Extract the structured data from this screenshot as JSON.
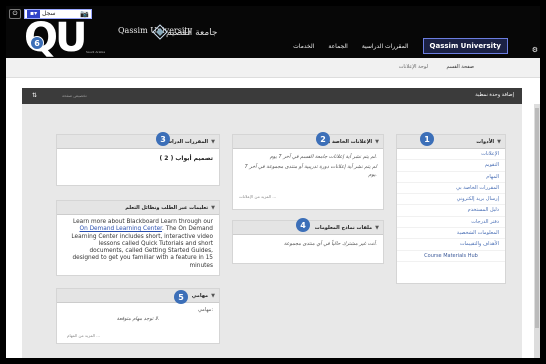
{
  "toolbar": {
    "power_icon": "power-icon",
    "recording_label": "سجل",
    "camera_icon": "camera-icon"
  },
  "header": {
    "logo": "QU",
    "logo_sub": "Saudi Arabia",
    "university_name_en": "Qassim University",
    "university_name_ar": "جامعة القصيم",
    "nav": [
      {
        "label": "الخدمات"
      },
      {
        "label": "الجماعة"
      },
      {
        "label": "المقررات الدراسية"
      }
    ],
    "active_tab": "Qassim University"
  },
  "subheader": {
    "tab_a": "صفحة القسم",
    "tab_b": "لوحة الإعلانات"
  },
  "page_bar": {
    "title": "إضافة وحدة نمطية",
    "left_icon": "⇅",
    "left_text": "تخصيص صفحة"
  },
  "modules": {
    "tools": {
      "title": "الأدوات",
      "items": [
        "الإعلانات",
        "التقويم",
        "المهام",
        "المقررات الخاصة بي",
        "إرسال بريد إلكتروني",
        "دليل المستخدم",
        "دفتر الدرجات",
        "المعلومات الشخصية",
        "الأهداف والتقييمات",
        "Course Materials Hub"
      ]
    },
    "my_announcements": {
      "title": "الإعلانات الخاصة بي",
      "lines": [
        "لم يتم نشر أية إعلانات جامعة القسم في آخر 7 يوم.",
        "لم يتم نشر أية إعلانات دورة تدريبية أو منتدى مجموعة في آخر 7 يوم."
      ],
      "more": "المزيد من الإعلانات ..."
    },
    "my_courses": {
      "title": "المقررات الدراسية",
      "content": "تصميم أبواب ( 2 )"
    },
    "new_content": {
      "title": "ملفات نماذج المعلومات",
      "text": "أنت غير مشترك حالياً في أي منتدى مجموعة."
    },
    "odl": {
      "title": "تعليمات عبر الطلب ونظائل التعلم",
      "text_before": "Learn more about Blackboard Learn through our ",
      "link": "On Demand Learning Center",
      "text_after": ". The On Demand Learning Center includes short, interactive video lessons called Quick Tutorials and short documents, called Getting Started Guides, designed to get you familiar with a feature in 15 minutes"
    },
    "tasks": {
      "title": "مهامي",
      "label": "مهامي:",
      "text": "لا توجد مهام متوقعة.",
      "more": "المزيد من المهام ..."
    }
  },
  "steps": [
    "1",
    "2",
    "3",
    "4",
    "5",
    "6"
  ]
}
